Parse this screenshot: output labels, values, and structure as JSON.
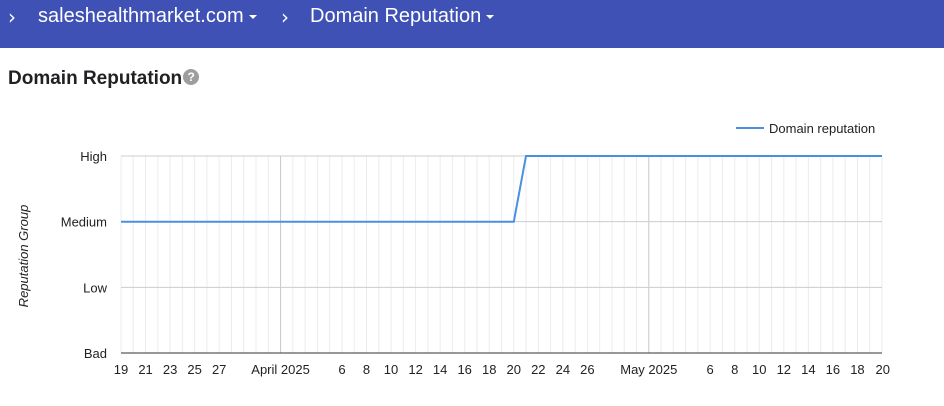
{
  "breadcrumb": {
    "items": [
      {
        "label": "saleshealthmarket.com"
      },
      {
        "label": "Domain Reputation"
      }
    ]
  },
  "page": {
    "title": "Domain Reputation",
    "help_glyph": "?"
  },
  "colors": {
    "header": "#3f51b5",
    "series": "#4a90e2"
  },
  "chart_data": {
    "type": "line",
    "title": "",
    "xlabel": "",
    "ylabel": "Reputation Group",
    "y_categories": [
      "Bad",
      "Low",
      "Medium",
      "High"
    ],
    "x_tick_labels": [
      "19",
      "21",
      "23",
      "25",
      "27",
      "April 2025",
      "6",
      "8",
      "10",
      "12",
      "14",
      "16",
      "18",
      "20",
      "22",
      "24",
      "26",
      "May 2025",
      "6",
      "8",
      "10",
      "12",
      "14",
      "16",
      "18",
      "20"
    ],
    "x_range": [
      "2025-03-19",
      "2025-05-20"
    ],
    "legend": {
      "position": "top-right",
      "entries": [
        "Domain reputation"
      ]
    },
    "grid": true,
    "series": [
      {
        "name": "Domain reputation",
        "points": [
          {
            "x": "2025-03-19",
            "y": "Medium"
          },
          {
            "x": "2025-04-20",
            "y": "Medium"
          },
          {
            "x": "2025-04-21",
            "y": "High"
          },
          {
            "x": "2025-05-20",
            "y": "High"
          }
        ]
      }
    ]
  }
}
